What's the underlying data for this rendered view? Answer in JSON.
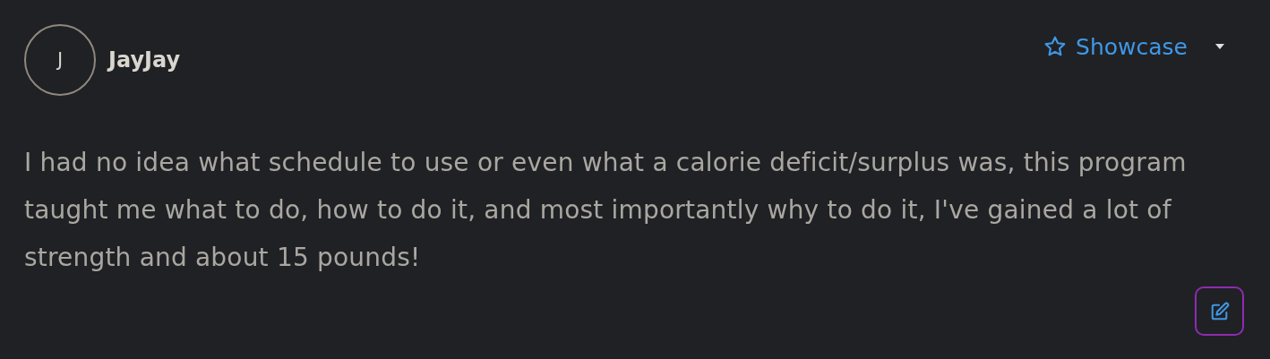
{
  "author": {
    "initial": "J",
    "name": "JayJay"
  },
  "badge": {
    "label": "Showcase"
  },
  "body": "I had no idea what schedule to use or even what a calorie deficit/surplus was, this program taught me what to do, how to do it, and most importantly why to do it, I've gained a lot of strength and about 15 pounds!"
}
